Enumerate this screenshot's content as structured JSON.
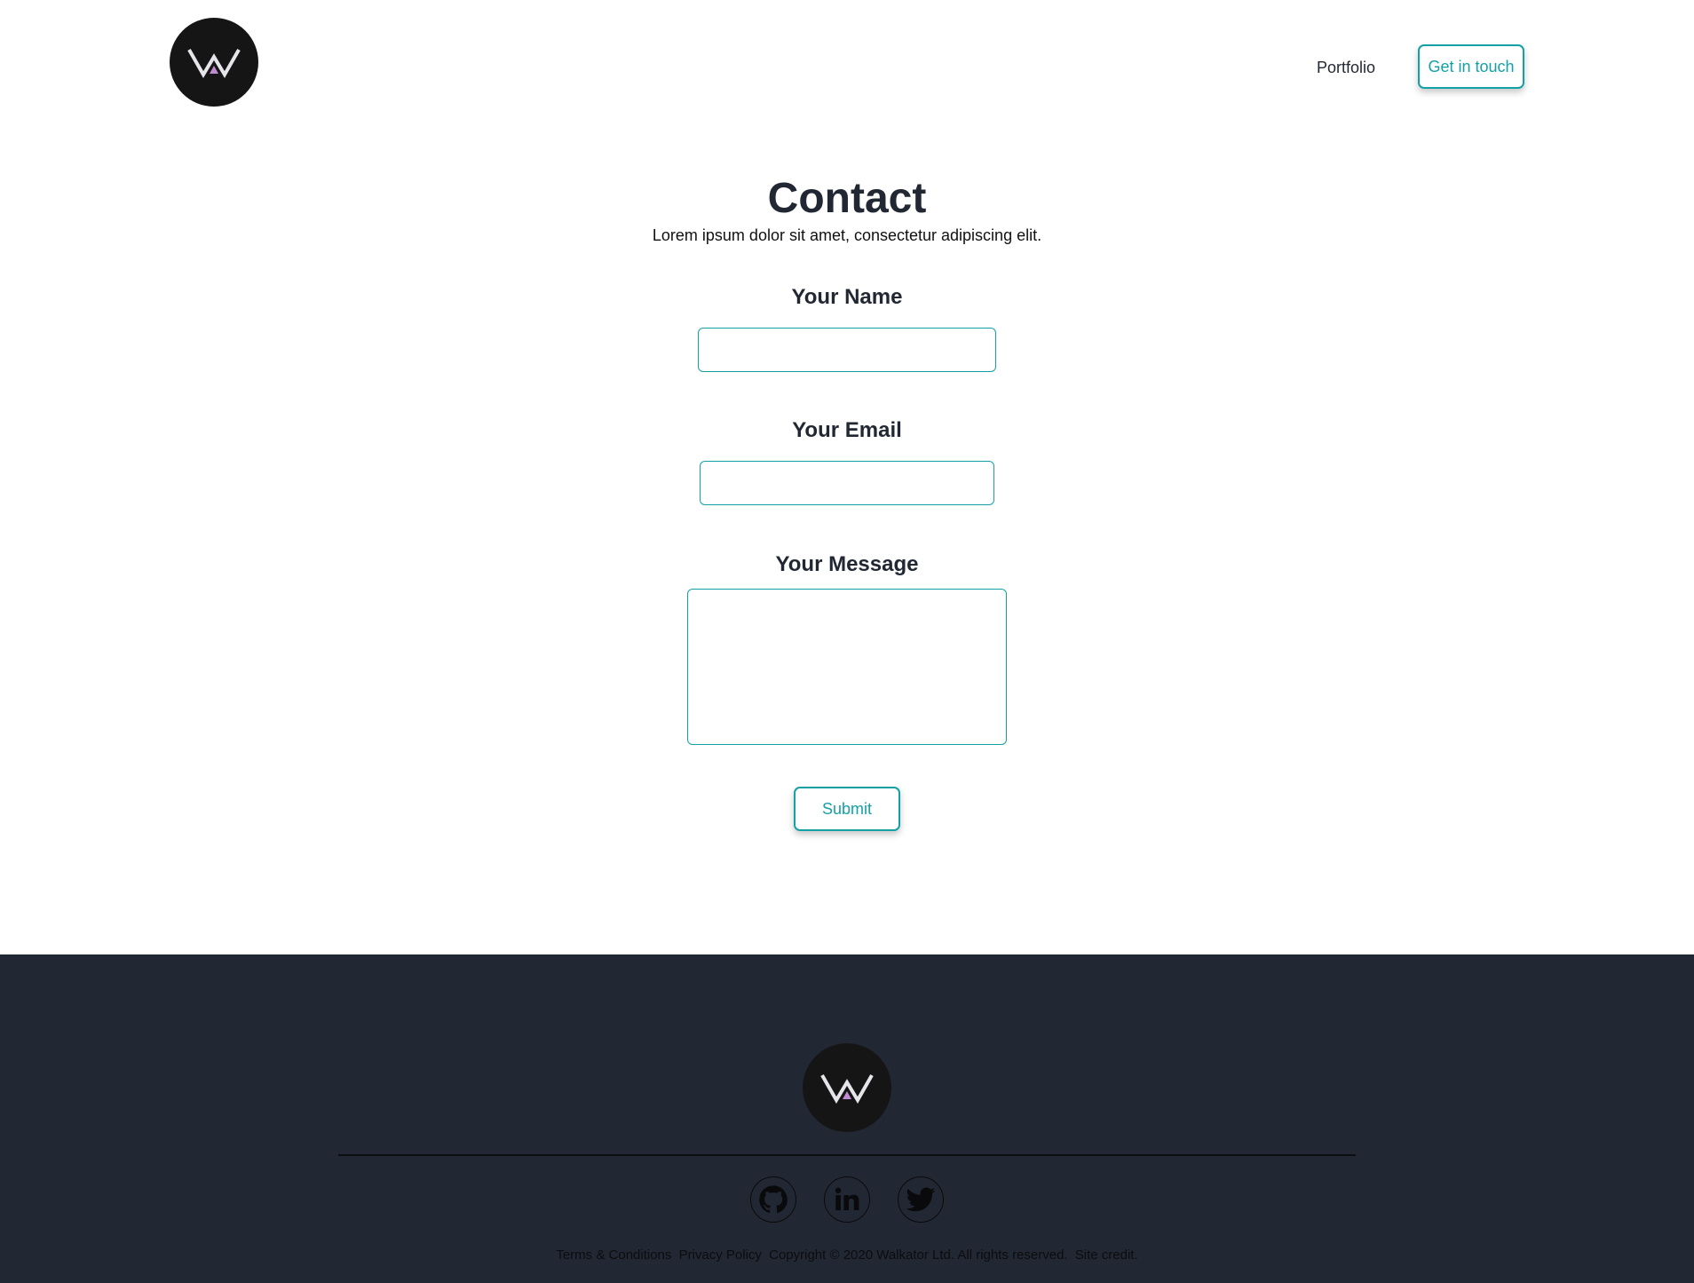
{
  "header": {
    "logo_icon": "w-logo-icon",
    "nav": {
      "portfolio_label": "Portfolio"
    },
    "cta_label": "Get in touch"
  },
  "contact": {
    "title": "Contact",
    "subtitle": "Lorem ipsum dolor sit amet, consectetur adipiscing elit.",
    "name_label": "Your Name",
    "name_value": "",
    "email_label": "Your Email",
    "email_value": "",
    "message_label": "Your Message",
    "message_value": "",
    "submit_label": "Submit"
  },
  "footer": {
    "logo_icon": "w-logo-icon",
    "social": [
      "github-icon",
      "linkedin-icon",
      "twitter-icon"
    ],
    "legal": {
      "terms": "Terms & Conditions",
      "privacy": "Privacy Policy",
      "copyright": "Copyright © 2020 Walkator Ltd. All rights reserved.",
      "credit": "Site credit."
    }
  },
  "colors": {
    "accent": "#14a1a6",
    "text_dark": "#222833",
    "footer_bg": "#222833",
    "logo_bg": "#151516"
  }
}
